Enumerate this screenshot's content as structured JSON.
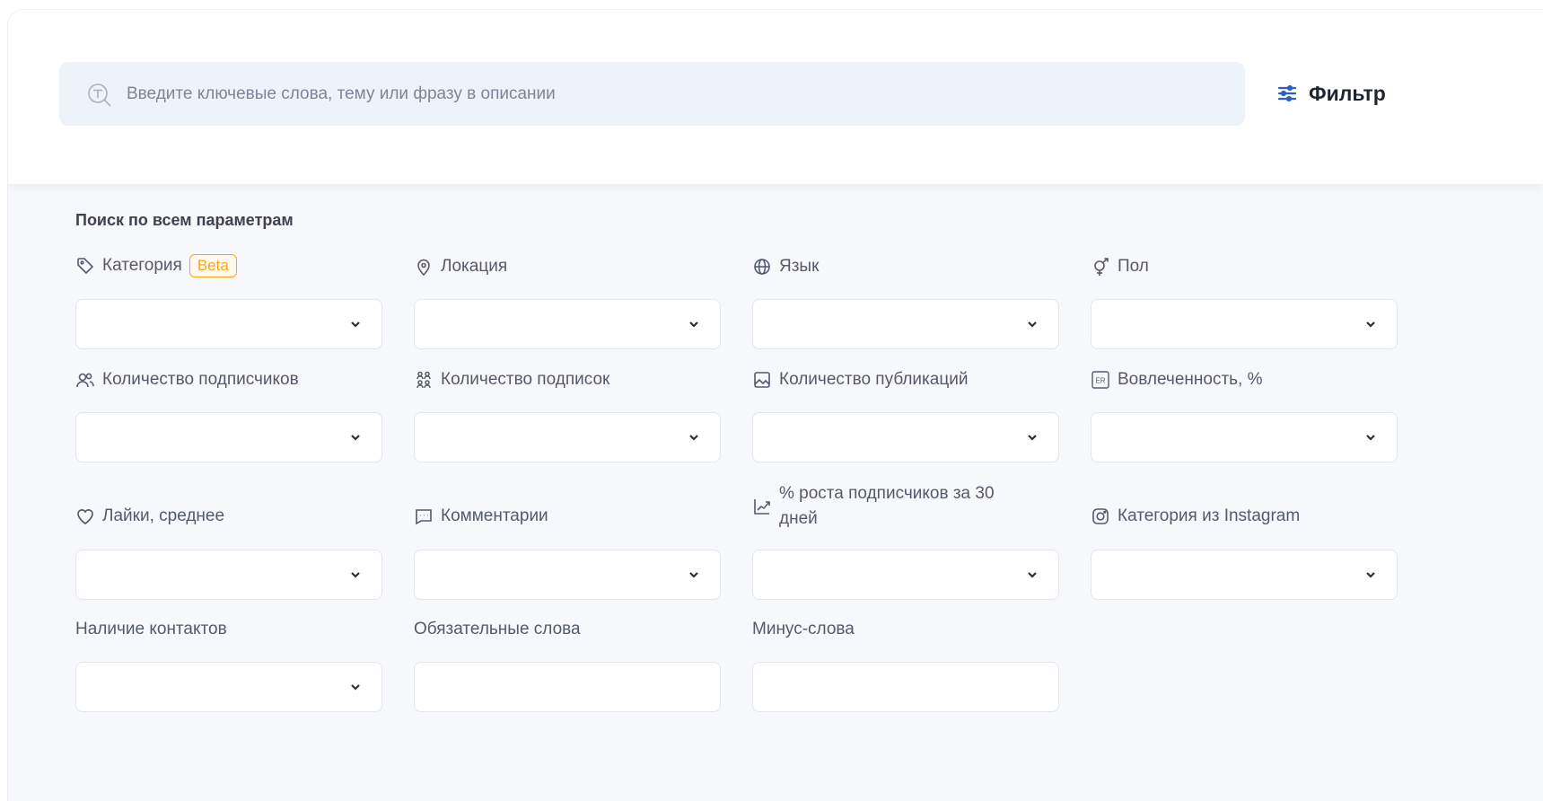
{
  "search": {
    "placeholder": "Введите ключевые слова, тему или фразу в описании",
    "value": ""
  },
  "filter_button": {
    "label": "Фильтр",
    "icon": "sliders-icon"
  },
  "panel": {
    "title": "Поиск по всем параметрам",
    "fields": [
      {
        "id": "category",
        "label": "Категория",
        "badge": "Beta",
        "icon": "tag-icon",
        "type": "select",
        "value": ""
      },
      {
        "id": "location",
        "label": "Локация",
        "icon": "location-pin-icon",
        "type": "select",
        "value": ""
      },
      {
        "id": "language",
        "label": "Язык",
        "icon": "globe-icon",
        "type": "select",
        "value": ""
      },
      {
        "id": "gender",
        "label": "Пол",
        "icon": "gender-icon",
        "type": "select",
        "value": ""
      },
      {
        "id": "followers",
        "label": "Количество подписчиков",
        "icon": "users-icon",
        "type": "select",
        "value": ""
      },
      {
        "id": "following",
        "label": "Количество подписок",
        "icon": "people-group-icon",
        "type": "select",
        "value": ""
      },
      {
        "id": "posts",
        "label": "Количество публикаций",
        "icon": "image-icon",
        "type": "select",
        "value": ""
      },
      {
        "id": "engagement",
        "label": "Вовлеченность, %",
        "icon": "er-icon",
        "icon_text": "ER",
        "type": "select",
        "value": ""
      },
      {
        "id": "likes",
        "label": "Лайки, среднее",
        "icon": "heart-icon",
        "type": "select",
        "value": ""
      },
      {
        "id": "comments",
        "label": "Комментарии",
        "icon": "comment-icon",
        "type": "select",
        "value": ""
      },
      {
        "id": "growth",
        "label_line1": "% роста подписчиков за 30",
        "label_line2": "дней",
        "icon": "growth-chart-icon",
        "type": "select",
        "value": ""
      },
      {
        "id": "ig_category",
        "label": "Категория из Instagram",
        "icon": "instagram-icon",
        "type": "select",
        "value": ""
      },
      {
        "id": "contacts",
        "label": "Наличие контактов",
        "type": "select",
        "value": ""
      },
      {
        "id": "required_words",
        "label": "Обязательные слова",
        "type": "text",
        "value": ""
      },
      {
        "id": "minus_words",
        "label": "Минус-слова",
        "type": "text",
        "value": ""
      }
    ]
  },
  "colors": {
    "accent": "#f5a623",
    "panel_bg": "#f7f8fb",
    "input_bg": "#eef2f9",
    "text": "#3d4250"
  }
}
